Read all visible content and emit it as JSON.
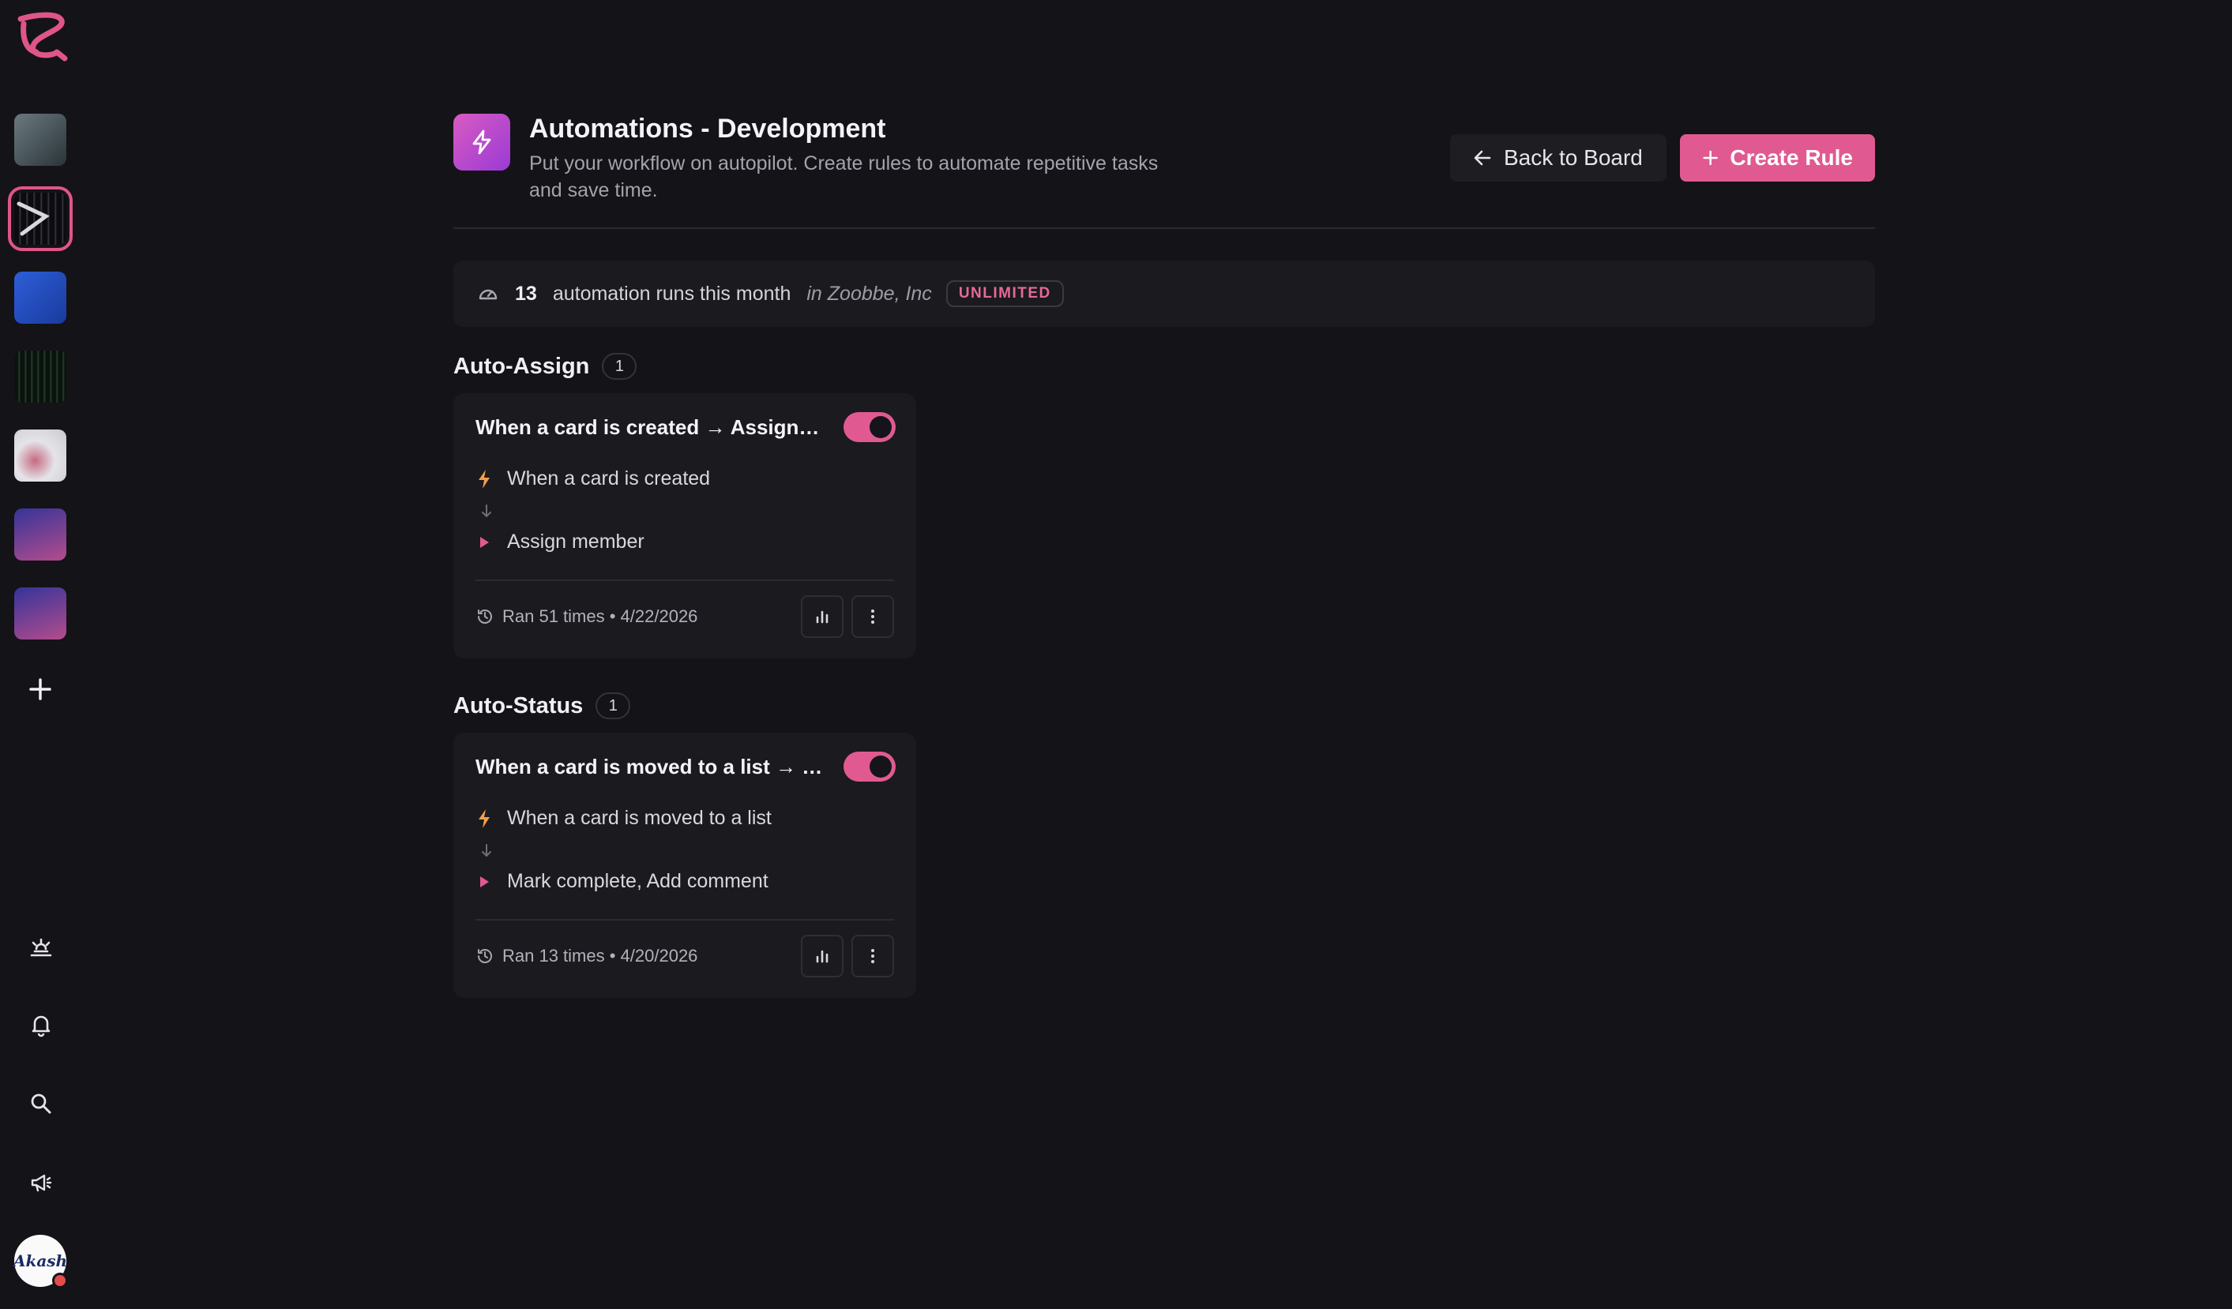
{
  "sidebar": {
    "logo_icon": "app-logo-icon",
    "boards": [
      {
        "name": "board-1",
        "colors": [
          "#5c6b73",
          "#2d3b40"
        ]
      },
      {
        "name": "board-2",
        "colors": [
          "#0d0d10",
          "#3a3a44"
        ],
        "active": true
      },
      {
        "name": "board-3",
        "colors": [
          "#2350c9",
          "#1a3fa8"
        ]
      },
      {
        "name": "board-4",
        "colors": [
          "#0b1510",
          "#203528"
        ]
      },
      {
        "name": "board-5",
        "colors": [
          "#d9d9de",
          "#b85c72"
        ]
      },
      {
        "name": "board-6",
        "colors": [
          "#3b3ba0",
          "#b34c8e"
        ]
      },
      {
        "name": "board-7",
        "colors": [
          "#3b3ba0",
          "#b34c8e"
        ]
      }
    ],
    "add_icon": "plus-icon",
    "bottom_icons": [
      "sunrise-icon",
      "bell-icon",
      "search-icon",
      "megaphone-icon"
    ],
    "avatar_text": "Akash",
    "avatar_status_color": "#e64b4b"
  },
  "header": {
    "title": "Automations - Development",
    "description": "Put your workflow on autopilot. Create rules to automate repetitive tasks and save time.",
    "icon": "lightning-icon",
    "back_label": "Back to Board",
    "create_label": "Create Rule"
  },
  "usage": {
    "count": "13",
    "text": "automation runs this month",
    "workspace": "in Zoobbe, Inc",
    "plan": "UNLIMITED"
  },
  "groups": [
    {
      "title": "Auto-Assign",
      "count": "1",
      "rule": {
        "name": "When a card is created → Assign member",
        "enabled": true,
        "trigger": "When a card is created",
        "action": "Assign member",
        "run_info": "Ran 51 times • 4/22/2026"
      }
    },
    {
      "title": "Auto-Status",
      "count": "1",
      "rule": {
        "name": "When a card is moved to a list → Mark complete, Add comment",
        "enabled": true,
        "trigger": "When a card is moved to a list",
        "action": "Mark complete, Add comment",
        "run_info": "Ran 13 times • 4/20/2026"
      }
    }
  ],
  "colors": {
    "accent": "#e05a91",
    "background": "#141317",
    "card": "#1b1a1f",
    "trigger_icon": "#f0a04b"
  }
}
